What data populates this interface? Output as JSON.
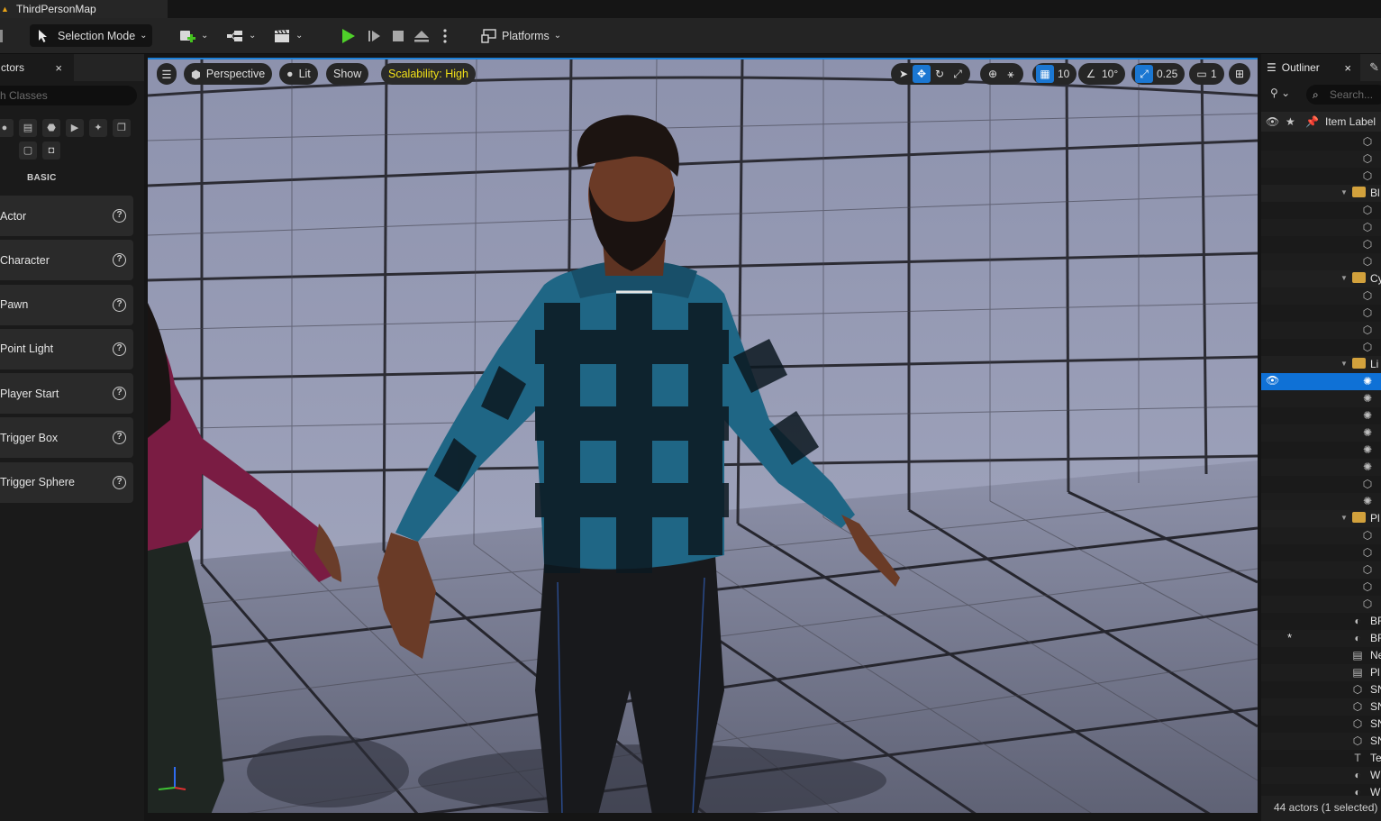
{
  "window": {
    "tab_title": "ThirdPersonMap"
  },
  "toolbar": {
    "selection_mode_label": "Selection Mode",
    "platforms_label": "Platforms"
  },
  "place_actors": {
    "tab_label": "ctors",
    "close": "×",
    "search_placeholder": "h Classes",
    "section_label": "BASIC",
    "items": [
      {
        "label": "Actor"
      },
      {
        "label": "Character"
      },
      {
        "label": "Pawn"
      },
      {
        "label": "Point Light"
      },
      {
        "label": "Player Start"
      },
      {
        "label": "Trigger Box"
      },
      {
        "label": "Trigger Sphere"
      }
    ],
    "help_glyph": "?"
  },
  "viewport": {
    "menu_glyph": "☰",
    "perspective_label": "Perspective",
    "lit_label": "Lit",
    "show_label": "Show",
    "scalability_label": "Scalability: High",
    "grid_snap": "10",
    "rotation_snap": "10°",
    "scale_snap": "0.25",
    "camera_speed": "1",
    "colors": {
      "accent": "#1c7fd6",
      "scalability_text": "#f1e018"
    }
  },
  "outliner": {
    "tab_label": "Outliner",
    "close": "×",
    "search_placeholder": "Search...",
    "column_label": "Item Label",
    "rows": [
      {
        "type": "actor",
        "label": ""
      },
      {
        "type": "actor",
        "label": ""
      },
      {
        "type": "actor",
        "label": ""
      },
      {
        "type": "folder",
        "label": "Bl"
      },
      {
        "type": "actor",
        "label": ""
      },
      {
        "type": "actor",
        "label": ""
      },
      {
        "type": "actor",
        "label": ""
      },
      {
        "type": "actor",
        "label": ""
      },
      {
        "type": "folder",
        "label": "Cy"
      },
      {
        "type": "actor",
        "label": ""
      },
      {
        "type": "actor",
        "label": ""
      },
      {
        "type": "actor",
        "label": ""
      },
      {
        "type": "actor",
        "label": ""
      },
      {
        "type": "folder",
        "label": "Li"
      },
      {
        "type": "light",
        "label": "",
        "selected": true
      },
      {
        "type": "light",
        "label": ""
      },
      {
        "type": "light",
        "label": ""
      },
      {
        "type": "light",
        "label": ""
      },
      {
        "type": "light",
        "label": ""
      },
      {
        "type": "light",
        "label": ""
      },
      {
        "type": "actor",
        "label": ""
      },
      {
        "type": "light",
        "label": ""
      },
      {
        "type": "folder",
        "label": "Pl"
      },
      {
        "type": "actor",
        "label": ""
      },
      {
        "type": "actor",
        "label": ""
      },
      {
        "type": "actor",
        "label": ""
      },
      {
        "type": "actor",
        "label": ""
      },
      {
        "type": "actor",
        "label": ""
      },
      {
        "type": "sphere",
        "label": "BF"
      },
      {
        "type": "sphere",
        "label": "BF",
        "starred": true
      },
      {
        "type": "other",
        "label": "Ne"
      },
      {
        "type": "other",
        "label": "Pl"
      },
      {
        "type": "actor",
        "label": "SN"
      },
      {
        "type": "actor",
        "label": "SN"
      },
      {
        "type": "actor",
        "label": "SN"
      },
      {
        "type": "actor",
        "label": "SN"
      },
      {
        "type": "text",
        "label": "Te"
      },
      {
        "type": "sphere",
        "label": "W"
      },
      {
        "type": "sphere",
        "label": "W"
      }
    ],
    "footer": "44 actors (1 selected)"
  }
}
